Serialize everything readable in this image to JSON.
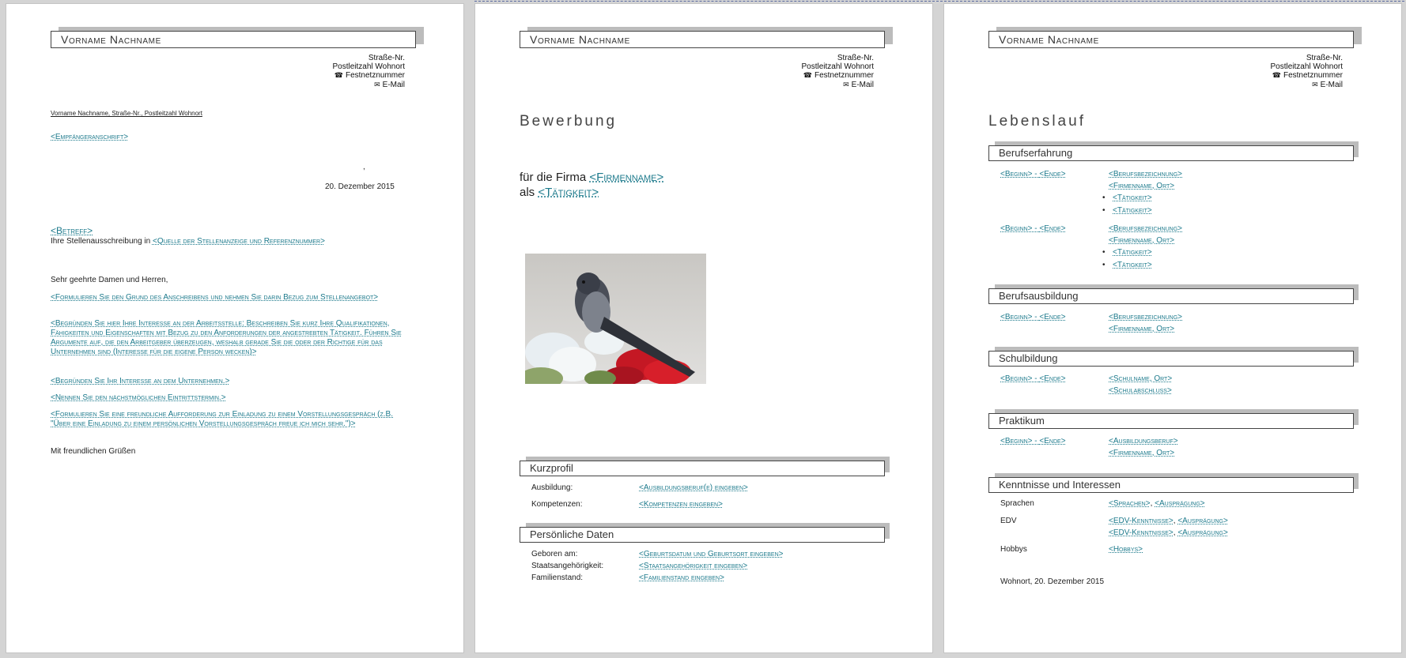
{
  "header": {
    "name": "Vorname Nachname",
    "street": "Straße-Nr.",
    "city": "Postleitzahl Wohnort",
    "phone": "Festnetznummer",
    "email": "E-Mail",
    "phone_icon": "☎",
    "email_icon": "✉"
  },
  "letter": {
    "sender_line": "Vorname Nachname, Straße-Nr., Postleitzahl Wohnort",
    "recipient": "<Empfängeranschrift>",
    "comma": ",",
    "date": "20. Dezember 2015",
    "subject": "<Betreff>",
    "ref_prefix": "Ihre Stellenausschreibung in ",
    "ref_placeholder": "<Quelle der Stellenanzeige und Referenznummer>",
    "salutation": "Sehr geehrte Damen und Herren,",
    "paragraphs": [
      "<Formulieren Sie den Grund des Anschreibens und nehmen Sie darin Bezug zum Stellenangebot>",
      "<Begründen Sie hier Ihre Interesse an der Arbeitsstelle: Beschreiben Sie kurz Ihre Qualifikationen, Fähigkeiten und Eigenschaften mit Bezug zu den Anforderungen der angestrebten Tätigkeit. Führen Sie Argumente auf, die den Arbeitgeber überzeugen, weshalb gerade Sie die oder der Richtige für das Unternehmen sind (Interesse für die eigene Person wecken)>",
      "<Begründen Sie Ihr Interesse an dem Unternehmen.>",
      "<Nennen Sie den nächstmöglichen Eintrittstermin.>",
      "<Formulieren Sie eine freundliche Aufforderung zur Einladung zu einem Vorstellungsgespräch (z.B. \"Über eine Einladung zu einem persönlichen Vorstellungsgespräch freue ich mich sehr.\")>"
    ],
    "closing": "Mit freundlichen Grüßen"
  },
  "cover": {
    "title": "Bewerbung",
    "firm_prefix": "für die Firma ",
    "firm_placeholder": "<Firmenname>",
    "job_prefix": "als ",
    "job_placeholder": "<Tätigkeit>",
    "photo_icon": "bird-photo",
    "kurzprofil_title": "Kurzprofil",
    "kurzprofil": [
      {
        "label": "Ausbildung:",
        "value": "<Ausbildungsberuf(e) eingeben>"
      },
      {
        "label": "Kompetenzen:",
        "value": "<Kompetenzen eingeben>"
      }
    ],
    "personal_title": "Persönliche Daten",
    "personal": [
      {
        "label": "Geboren am:",
        "value": "<Geburtsdatum und Geburtsort eingeben>"
      },
      {
        "label": "Staatsangehörigkeit:",
        "value": "<Staatsangehörigkeit eingeben>"
      },
      {
        "label": "Familienstand:",
        "value": "<Familienstand eingeben>"
      }
    ]
  },
  "cv": {
    "title": "Lebenslauf",
    "begin": "<Beginn>",
    "dash": " - ",
    "end": "<Ende>",
    "bullet": "•",
    "berufserfahrung_title": "Berufserfahrung",
    "job1": {
      "title": "<Berufsbezeichnung>",
      "firm": "<Firmenname, Ort>",
      "tasks": [
        "<Tätigkeit>",
        "<Tätigkeit>"
      ]
    },
    "job2": {
      "title": "<Berufsbezeichnung>",
      "firm": "<Firmenname, Ort>",
      "tasks": [
        "<Tätigkeit>",
        "<Tätigkeit>"
      ]
    },
    "berufsausbildung_title": "Berufsausbildung",
    "training": {
      "title": "<Berufsbezeichnung>",
      "firm": "<Firmenname, Ort>"
    },
    "schulbildung_title": "Schulbildung",
    "school": {
      "name": "<Schulname, Ort>",
      "degree": "<Schulabschluss>"
    },
    "praktikum_title": "Praktikum",
    "internship": {
      "title": "<Ausbildungsberuf>",
      "firm": "<Firmenname, Ort>"
    },
    "skills_title": "Kenntnisse und Interessen",
    "sprachen_label": "Sprachen",
    "sprachen_value": "<Sprachen>",
    "auspraegung": "<Ausprägung>",
    "sep": ", ",
    "edv_label": "EDV",
    "edv_value": "<EDV-Kenntnisse>",
    "hobbys_label": "Hobbys",
    "hobbys_value": "<Hobbys>",
    "place_date": "Wohnort, 20. Dezember 2015"
  }
}
